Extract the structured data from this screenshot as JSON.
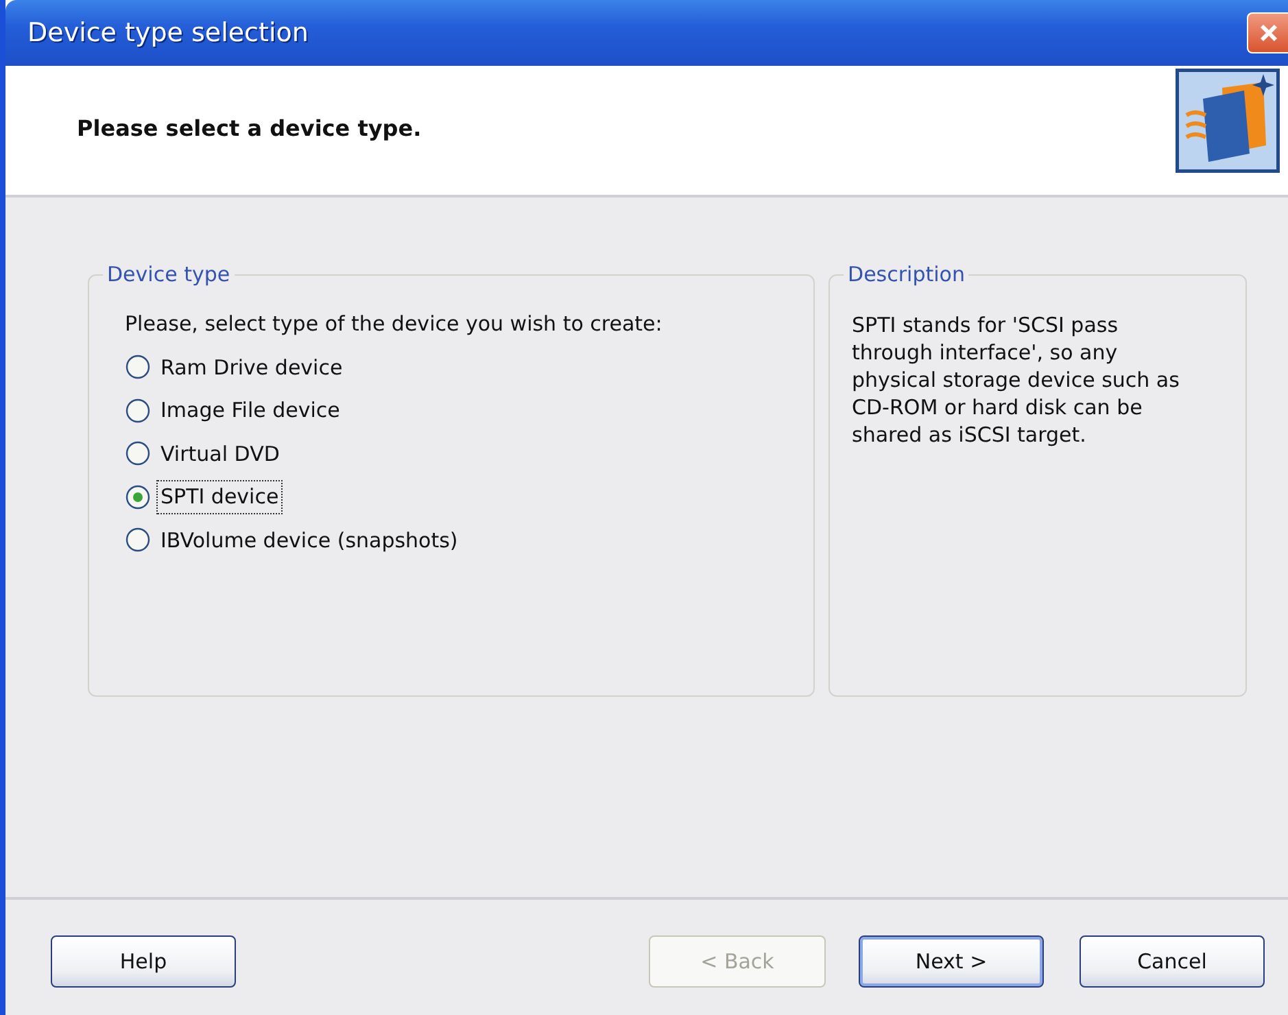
{
  "window": {
    "title": "Device type selection"
  },
  "header": {
    "title": "Please select a device type."
  },
  "device_group": {
    "legend": "Device type",
    "prompt": "Please, select type of the device you wish to create:",
    "options": [
      {
        "label": "Ram Drive device",
        "selected": false
      },
      {
        "label": "Image File device",
        "selected": false
      },
      {
        "label": "Virtual DVD",
        "selected": false
      },
      {
        "label": "SPTI device",
        "selected": true
      },
      {
        "label": "IBVolume device (snapshots)",
        "selected": false
      }
    ]
  },
  "description": {
    "legend": "Description",
    "text": "SPTI stands for 'SCSI pass through interface', so any physical storage device such as CD-ROM or hard disk can be shared as iSCSI target."
  },
  "buttons": [
    {
      "label": "Help",
      "disabled": false,
      "default": false
    },
    {
      "label": "< Back",
      "disabled": true,
      "default": false
    },
    {
      "label": "Next >",
      "disabled": false,
      "default": true
    },
    {
      "label": "Cancel",
      "disabled": false,
      "default": false
    }
  ]
}
